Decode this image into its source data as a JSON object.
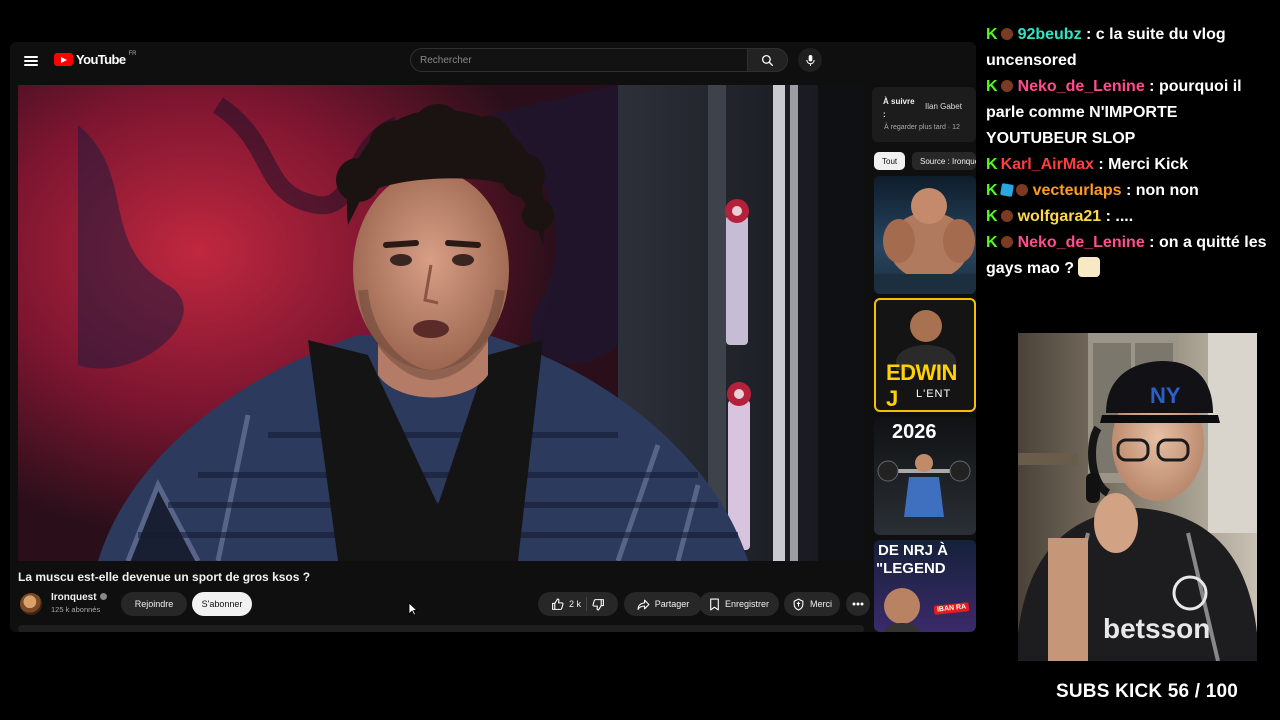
{
  "youtube": {
    "logo_text": "YouTube",
    "region": "FR",
    "search_placeholder": "Rechercher",
    "video_title": "La muscu est-elle devenue un sport de gros ksos ?",
    "channel_name": "Ironquest",
    "channel_subs": "125 k abonnés",
    "join_label": "Rejoindre",
    "subscribe_label": "S'abonner",
    "like_count": "2 k",
    "share_label": "Partager",
    "save_label": "Enregistrer",
    "thanks_label": "Merci",
    "up_next": {
      "label": "À suivre :",
      "channel": "Ilan Gabet",
      "watch_later": "À regarder plus tard · 12"
    },
    "chips": [
      "Tout",
      "Source : Ironquest"
    ],
    "thumbnails": {
      "t2_big": "EDWIN J",
      "t2_small": "L'ENT",
      "t3_big": "2026",
      "t4_line1": "DE NRJ À",
      "t4_line2": "\"LEGEND",
      "t4_tag": "IBAN RA"
    }
  },
  "chat": {
    "messages": [
      {
        "user": "92beubz",
        "text": ": c la suite du vlog uncensored",
        "color": "#2ee6c6"
      },
      {
        "user": "Neko_de_Lenine",
        "text": ": pourquoi il parle comme N'IMPORTE YOUTUBEUR SLOP",
        "color": "#ff4d8d"
      },
      {
        "user": "Karl_AirMax",
        "text": ": Merci Kick",
        "color": "#ff3d3d"
      },
      {
        "user": "vecteurlaps",
        "text": ": non non",
        "color": "#ff9b21"
      },
      {
        "user": "wolfgara21",
        "text": ": ....",
        "color": "#ffd84a"
      },
      {
        "user": "Neko_de_Lenine",
        "text": ": on a quitté les gays mao ?",
        "color": "#ff4d8d"
      }
    ]
  },
  "subs_counter": "SUBS KICK 56 / 100",
  "colors": {
    "kick_green": "#53fc18",
    "youtube_red": "#ff0000",
    "yt_bg": "#0f0f0f"
  }
}
